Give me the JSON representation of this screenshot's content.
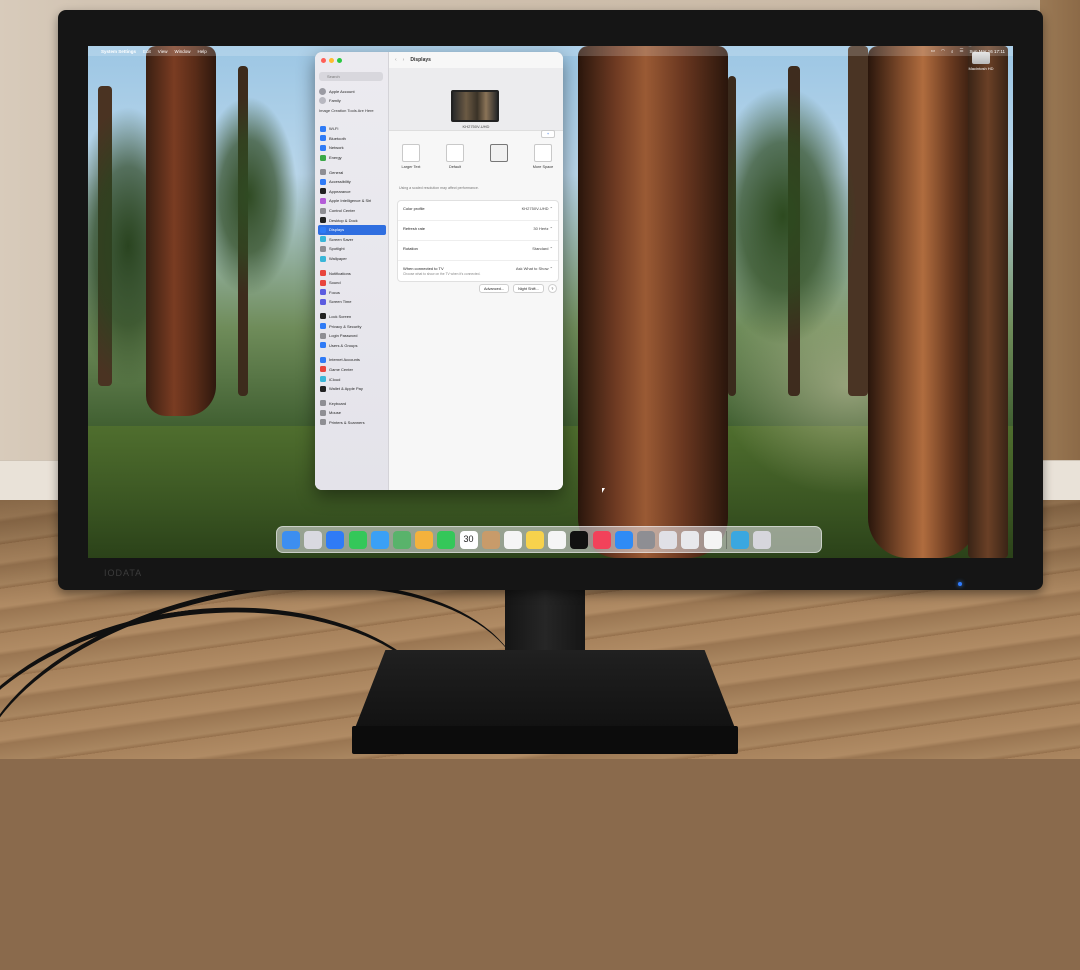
{
  "menubar": {
    "app": "System Settings",
    "menus": [
      "Edit",
      "View",
      "Window",
      "Help"
    ],
    "date_time": "Sun Mar 16  17:11"
  },
  "desktop": {
    "drive_label": "Macintosh HD"
  },
  "window": {
    "title": "Displays",
    "search_placeholder": "Search",
    "user_name": "Apple Account",
    "family_label": "Family",
    "promo_text": "Image Creation Tools Are Here",
    "sidebar": [
      {
        "label": "Wi-Fi",
        "color": "#2f7bf6"
      },
      {
        "label": "Bluetooth",
        "color": "#2f7bf6"
      },
      {
        "label": "Network",
        "color": "#2f7bf6"
      },
      {
        "label": "Energy",
        "color": "#3aa846"
      },
      {
        "label": "General",
        "color": "#8e8e93"
      },
      {
        "label": "Accessibility",
        "color": "#2f7bf6"
      },
      {
        "label": "Appearance",
        "color": "#222222"
      },
      {
        "label": "Apple Intelligence & Siri",
        "color": "#b45cd8"
      },
      {
        "label": "Control Center",
        "color": "#8e8e93"
      },
      {
        "label": "Desktop & Dock",
        "color": "#222222"
      },
      {
        "label": "Displays",
        "color": "#2f7bf6",
        "active": true
      },
      {
        "label": "Screen Saver",
        "color": "#39b6d8"
      },
      {
        "label": "Spotlight",
        "color": "#8e8e93"
      },
      {
        "label": "Wallpaper",
        "color": "#39b6d8"
      },
      {
        "label": "Notifications",
        "color": "#e8453c"
      },
      {
        "label": "Sound",
        "color": "#e8453c"
      },
      {
        "label": "Focus",
        "color": "#5c5ce0"
      },
      {
        "label": "Screen Time",
        "color": "#5c5ce0"
      },
      {
        "label": "Lock Screen",
        "color": "#222222"
      },
      {
        "label": "Privacy & Security",
        "color": "#2f7bf6"
      },
      {
        "label": "Login Password",
        "color": "#8e8e93"
      },
      {
        "label": "Users & Groups",
        "color": "#2f7bf6"
      },
      {
        "label": "Internet Accounts",
        "color": "#2f7bf6"
      },
      {
        "label": "Game Center",
        "color": "#e8453c"
      },
      {
        "label": "iCloud",
        "color": "#39b6d8"
      },
      {
        "label": "Wallet & Apple Pay",
        "color": "#222222"
      },
      {
        "label": "Keyboard",
        "color": "#8e8e93"
      },
      {
        "label": "Mouse",
        "color": "#8e8e93"
      },
      {
        "label": "Printers & Scanners",
        "color": "#8e8e93"
      }
    ],
    "display_name": "KH2750V-UHD",
    "plus_label": "+",
    "resolutions": [
      {
        "label": "Larger Text"
      },
      {
        "label": "Default"
      },
      {
        "label": ""
      },
      {
        "label": "More Space"
      }
    ],
    "resolution_note": "Using a scaled resolution may affect performance.",
    "settings": [
      {
        "label": "Color profile",
        "value": "KH2750V-UHD"
      },
      {
        "label": "Refresh rate",
        "value": "30 Hertz"
      },
      {
        "label": "Rotation",
        "value": "Standard"
      },
      {
        "label": "When connected to TV",
        "value": "Ask What to Show",
        "sub": "Choose what to show on the TV when it's connected."
      }
    ],
    "buttons": {
      "advanced": "Advanced...",
      "night_shift": "Night Shift...",
      "help": "?"
    }
  },
  "monitor": {
    "brand": "IODATA"
  },
  "dock": [
    {
      "name": "finder",
      "color": "#3d8ef0"
    },
    {
      "name": "launchpad",
      "color": "#d9d9e0"
    },
    {
      "name": "safari",
      "color": "#2f7bf6"
    },
    {
      "name": "messages",
      "color": "#34c759"
    },
    {
      "name": "mail",
      "color": "#3aa0f5"
    },
    {
      "name": "maps",
      "color": "#59b36b"
    },
    {
      "name": "photos",
      "color": "#f4b23c"
    },
    {
      "name": "facetime",
      "color": "#34c759"
    },
    {
      "name": "calendar",
      "color": "#ffffff"
    },
    {
      "name": "contacts",
      "color": "#c89b6a"
    },
    {
      "name": "reminders",
      "color": "#f5f5f5"
    },
    {
      "name": "notes",
      "color": "#f7d24c"
    },
    {
      "name": "freeform",
      "color": "#f5f5f5"
    },
    {
      "name": "tv",
      "color": "#111111"
    },
    {
      "name": "music",
      "color": "#f2425a"
    },
    {
      "name": "app-store",
      "color": "#2f8bf6"
    },
    {
      "name": "system-settings",
      "color": "#8e8e93"
    },
    {
      "name": "iphone-mirroring",
      "color": "#e0e0e6"
    },
    {
      "name": "preview",
      "color": "#e8e8ec"
    },
    {
      "name": "home",
      "color": "#f4f4f4"
    },
    {
      "name": "downloads",
      "color": "#3aa7e0"
    },
    {
      "name": "trash",
      "color": "#d6d6dc"
    }
  ],
  "dock_calendar_day": "30"
}
